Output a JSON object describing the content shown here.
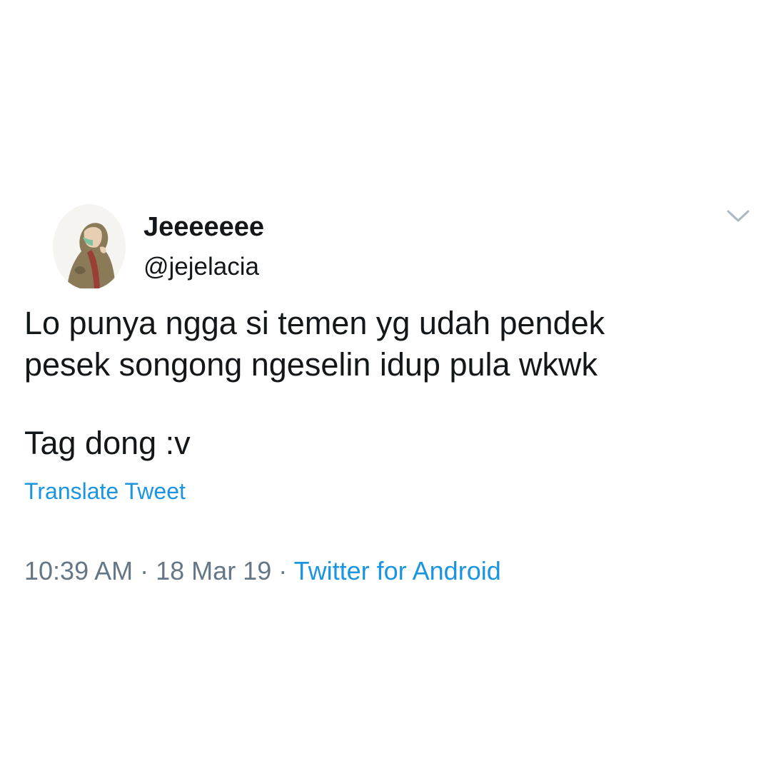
{
  "user": {
    "display_name": "Jeeeeeee",
    "handle": "@jejelacia"
  },
  "tweet": {
    "line1": "Lo punya ngga si temen yg udah pendek",
    "line2": "pesek songong ngeselin idup pula wkwk",
    "line3": "Tag dong :v"
  },
  "translate_label": "Translate Tweet",
  "meta": {
    "time": "10:39 AM",
    "separator": "·",
    "date": "18 Mar 19",
    "source": "Twitter for Android"
  },
  "icons": {
    "menu": "chevron-down-icon"
  },
  "colors": {
    "link": "#1b95e0",
    "meta": "#657786",
    "text": "#14171a"
  }
}
